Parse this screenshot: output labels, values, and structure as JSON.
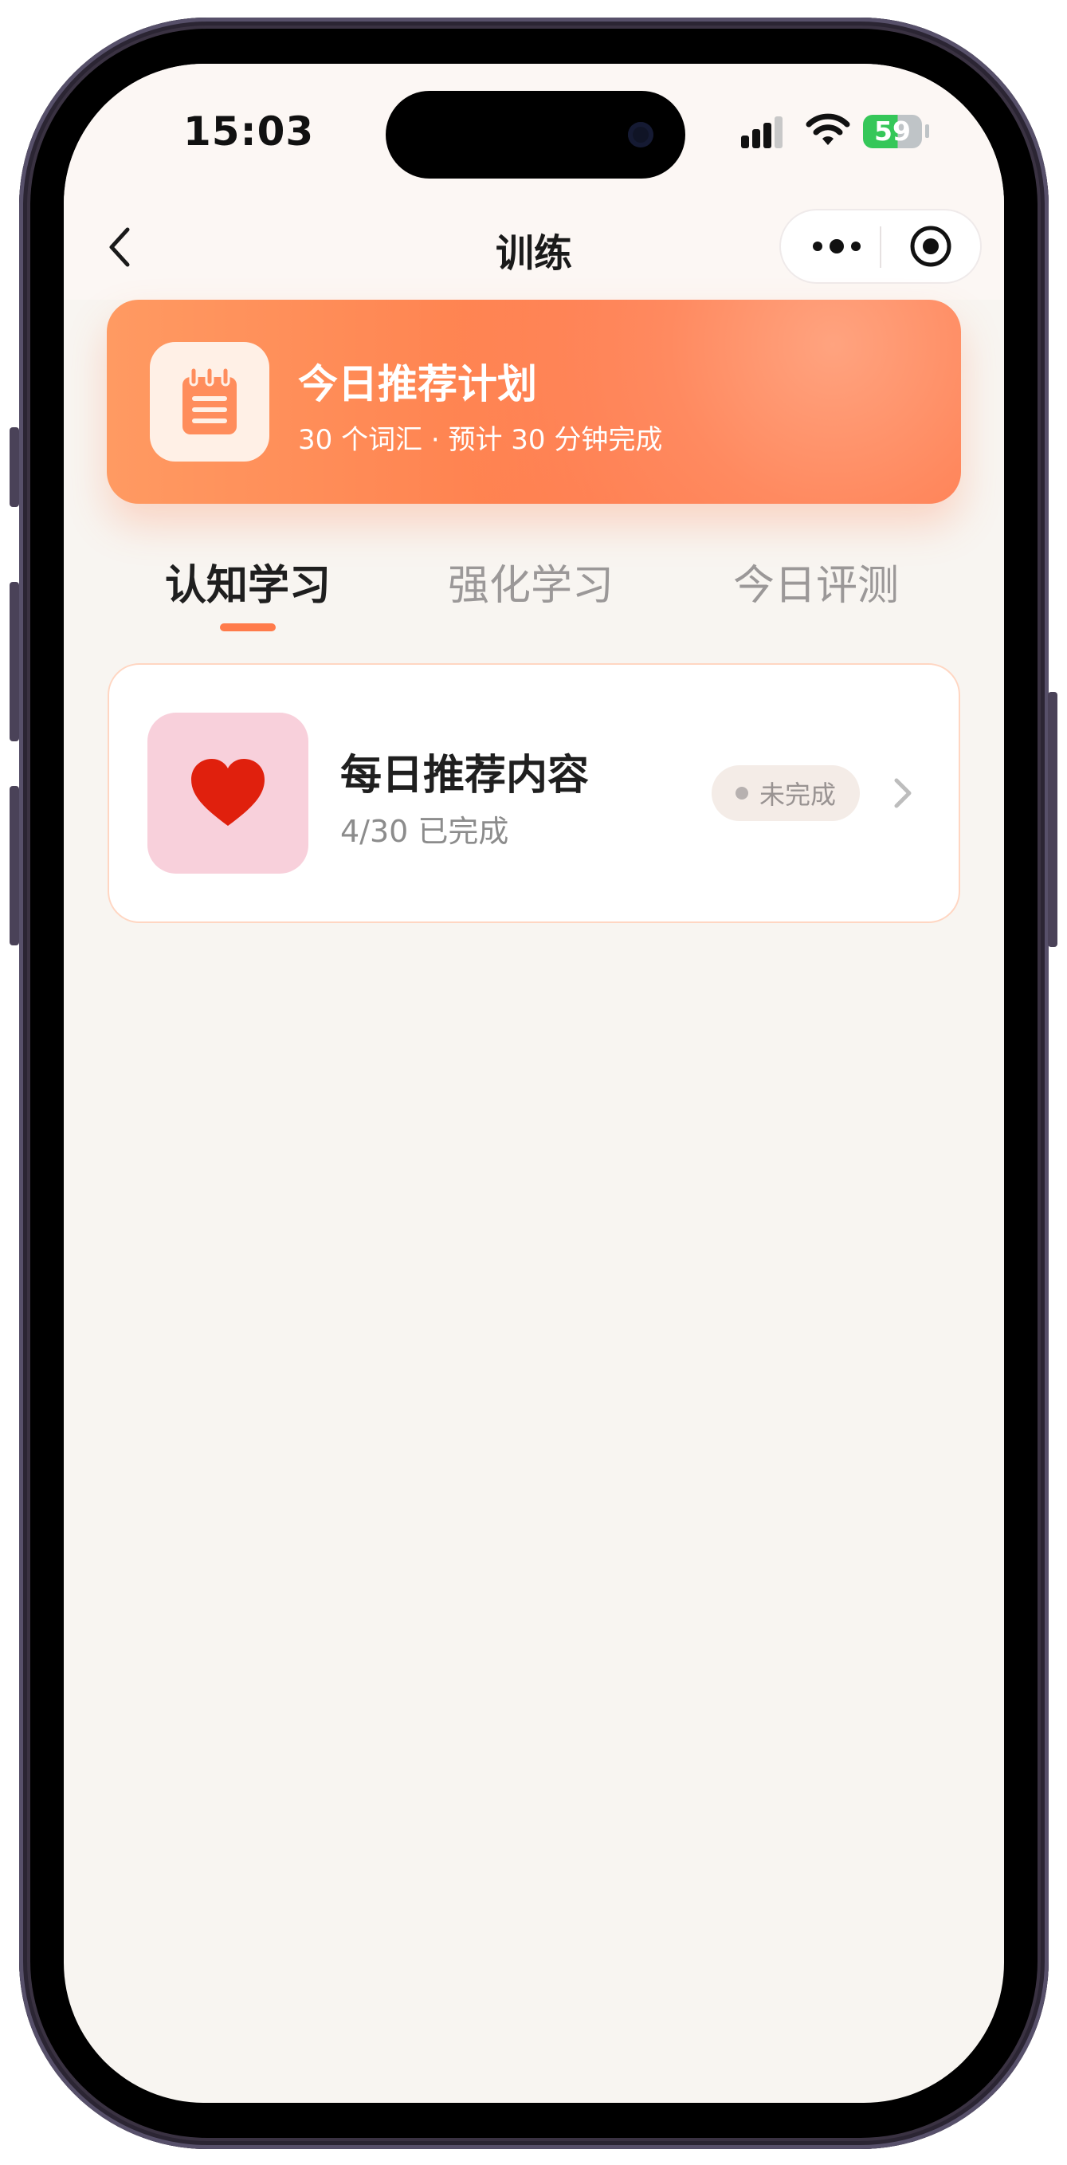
{
  "status_bar": {
    "time": "15:03",
    "battery_level": "59"
  },
  "nav": {
    "title": "训练",
    "back_icon": "chevron-left-icon",
    "more_icon": "more-dots-icon",
    "close_icon": "target-circle-icon"
  },
  "plan": {
    "title": "今日推荐计划",
    "subtitle": "30 个词汇 · 预计 30 分钟完成",
    "icon": "notepad-icon"
  },
  "tabs": [
    {
      "label": "认知学习",
      "active": true
    },
    {
      "label": "强化学习",
      "active": false
    },
    {
      "label": "今日评测",
      "active": false
    }
  ],
  "items": [
    {
      "title": "每日推荐内容",
      "progress": "4/30 已完成",
      "status": "未完成",
      "icon": "heart-icon"
    }
  ],
  "colors": {
    "accent": "#ff7b4b",
    "background": "#f8f5f1",
    "heart": "#e0200d",
    "icon_bg_pink": "#f8d0db"
  }
}
